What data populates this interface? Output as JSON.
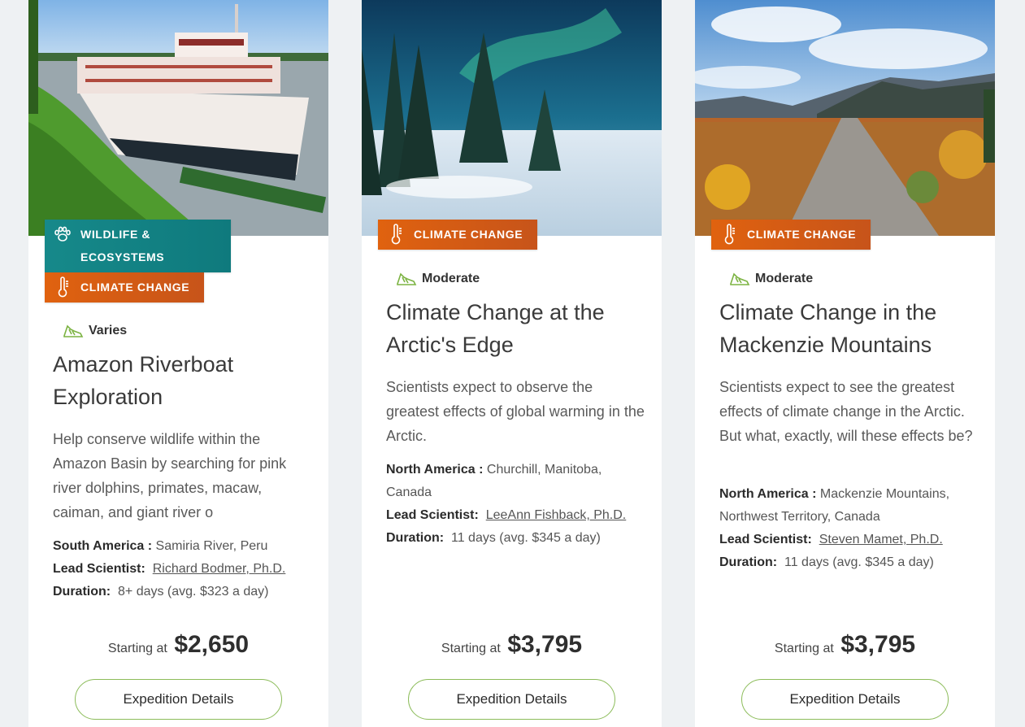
{
  "colors": {
    "teal": "#0f7a7d",
    "orange": "#d9601a",
    "button_border": "#8cbc5a",
    "difficulty_green": "#7cb342"
  },
  "cards": [
    {
      "badges": [
        {
          "label": "WILDLIFE & ECOSYSTEMS",
          "icon": "paw-icon"
        },
        {
          "label": "CLIMATE CHANGE",
          "icon": "thermometer-icon"
        }
      ],
      "difficulty": "Varies",
      "title": "Amazon Riverboat Exploration",
      "description": "Help conserve wildlife within the Amazon Basin by searching for pink river dolphins, primates, macaw, caiman, and giant river o",
      "region_label": "South America :",
      "region_value": "Samiria River, Peru",
      "scientist_label": "Lead Scientist:",
      "scientist_name": "Richard Bodmer, Ph.D.",
      "duration_label": "Duration:",
      "duration_value": "8+ days (avg. $323 a day)",
      "price_prefix": "Starting at",
      "price": "$2,650",
      "button": "Expedition Details"
    },
    {
      "badges": [
        {
          "label": "CLIMATE CHANGE",
          "icon": "thermometer-icon"
        }
      ],
      "difficulty": "Moderate",
      "title": "Climate Change at the Arctic's Edge",
      "description": "Scientists expect to observe the greatest effects of global warming in the Arctic.",
      "region_label": "North America :",
      "region_value": "Churchill, Manitoba, Canada",
      "scientist_label": "Lead Scientist:",
      "scientist_name": "LeeAnn Fishback, Ph.D.",
      "duration_label": "Duration:",
      "duration_value": "11 days (avg. $345 a day)",
      "price_prefix": "Starting at",
      "price": "$3,795",
      "button": "Expedition Details"
    },
    {
      "badges": [
        {
          "label": "CLIMATE CHANGE",
          "icon": "thermometer-icon"
        }
      ],
      "difficulty": "Moderate",
      "title": "Climate Change in the Mackenzie Mountains",
      "description": "Scientists expect to see the greatest effects of climate change in the Arctic. But what, exactly, will these effects be?",
      "region_label": "North America :",
      "region_value": "Mackenzie Mountains, Northwest Territory, Canada",
      "scientist_label": "Lead Scientist:",
      "scientist_name": "Steven Mamet, Ph.D.",
      "duration_label": "Duration:",
      "duration_value": "11 days (avg. $345 a day)",
      "price_prefix": "Starting at",
      "price": "$3,795",
      "button": "Expedition Details"
    }
  ]
}
